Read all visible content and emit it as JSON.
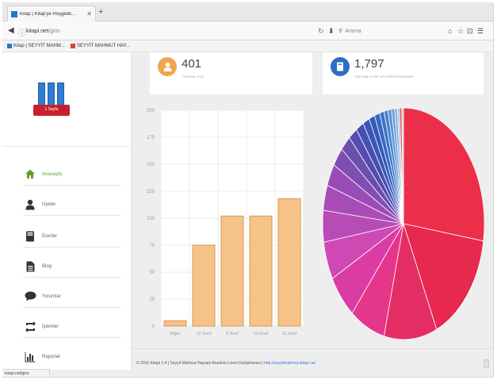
{
  "browser": {
    "tab_title": "Kitap | Kitap'ye Hoşgeldi...",
    "new_tab_label": "+",
    "url_domain": "kitapi.net",
    "url_path": "/giris",
    "search_placeholder": "Arama",
    "bookmarks": [
      {
        "label": "Kitap | SEYYİT MAHM...",
        "color": "#2b77c6"
      },
      {
        "label": "SEYYİT MAHMUT HAY...",
        "color": "#d9452b"
      }
    ],
    "status_url": "kitapi.net/giris"
  },
  "logo": {
    "banner_text": "1 Sayfa"
  },
  "sidebar": {
    "items": [
      {
        "label": "Anasayfa",
        "icon": "home-icon",
        "active": true
      },
      {
        "label": "Üyeler",
        "icon": "user-icon",
        "active": false
      },
      {
        "label": "Eserler",
        "icon": "book-icon",
        "active": false
      },
      {
        "label": "Blog",
        "icon": "document-icon",
        "active": false
      },
      {
        "label": "Yorumlar",
        "icon": "comment-icon",
        "active": false
      },
      {
        "label": "İşlemler",
        "icon": "exchange-icon",
        "active": false
      },
      {
        "label": "Raporlar",
        "icon": "bar-chart-icon",
        "active": false
      }
    ]
  },
  "stats": {
    "users": {
      "value": "401",
      "label": "TOPLAM ÜYE",
      "color": "#f0a54b"
    },
    "books": {
      "value": "1,797",
      "label": "TOPLAM KİTAP VE DİĞER ESERLER",
      "color": "#2f6fbf"
    }
  },
  "footer": {
    "text": "© 2015 Kitapi 1.4 | Seyyit Mahmut Hayrani Anadolu Lisesi Kütüphanesi |",
    "link": "http://seyyitmahmut.kitapi.net"
  },
  "chart_data": [
    {
      "type": "bar",
      "categories": [
        "Diğer",
        "12.Sınıf",
        "9.Sınıf",
        "10.Sınıf",
        "11.Sınıf"
      ],
      "values": [
        5,
        75,
        102,
        102,
        118
      ],
      "ylim": [
        0,
        200
      ],
      "yticks": [
        0,
        25,
        50,
        75,
        100,
        125,
        150,
        175,
        200
      ],
      "bar_color": "#f5c287",
      "bar_stroke": "#d59a56",
      "grid": true
    },
    {
      "type": "pie",
      "values": [
        31,
        18,
        12,
        8,
        7,
        6,
        5,
        4,
        3.5,
        3,
        2.5,
        2,
        1.8,
        1.5,
        1.3,
        1.2,
        1,
        0.9,
        0.8,
        0.7,
        0.6,
        0.5,
        0.5,
        0.4
      ],
      "colors": [
        "#ec2f48",
        "#e7284f",
        "#e52d65",
        "#e4368a",
        "#db3ca3",
        "#cf49b5",
        "#b84cb7",
        "#a84db8",
        "#9a4cb6",
        "#7f4db3",
        "#6a4fae",
        "#564bb0",
        "#4450b3",
        "#3a56b6",
        "#335ab9",
        "#3767c0",
        "#3c73c6",
        "#4a82cd",
        "#5a91d3",
        "#6d9fd8",
        "#86b0dd",
        "#a7c3e3",
        "#e05555",
        "#c2c9d1"
      ]
    }
  ]
}
